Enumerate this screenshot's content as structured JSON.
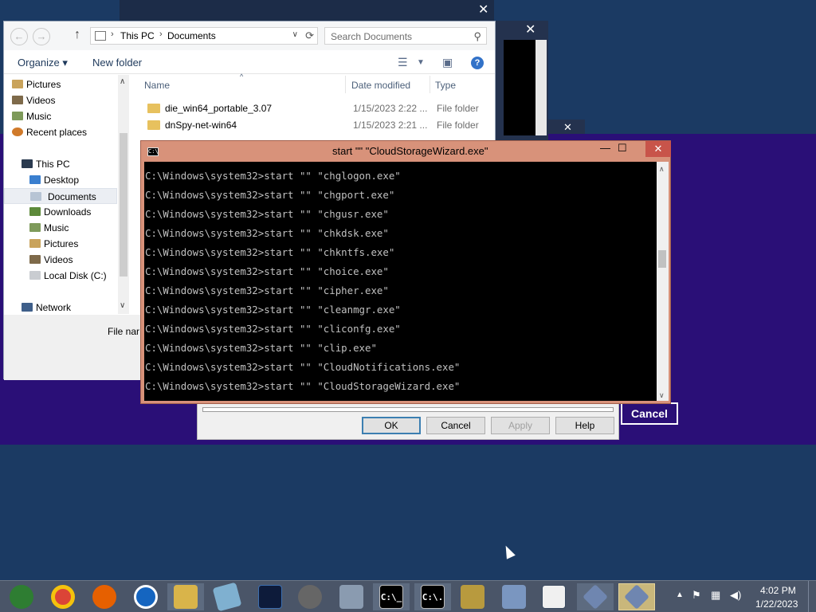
{
  "explorer": {
    "path": [
      "This PC",
      "Documents"
    ],
    "search_placeholder": "Search Documents",
    "organize_label": "Organize",
    "new_folder_label": "New folder",
    "columns": {
      "name": "Name",
      "date_modified": "Date modified",
      "type": "Type"
    },
    "nav_items": [
      {
        "label": "Pictures",
        "icon": "pictures-icon"
      },
      {
        "label": "Videos",
        "icon": "videos-icon"
      },
      {
        "label": "Music",
        "icon": "music-icon"
      },
      {
        "label": "Recent places",
        "icon": "recent-places-icon"
      },
      {
        "label": "This PC",
        "icon": "computer-icon"
      },
      {
        "label": "Desktop",
        "icon": "desktop-icon"
      },
      {
        "label": "Documents",
        "icon": "documents-icon",
        "selected": true
      },
      {
        "label": "Downloads",
        "icon": "downloads-icon"
      },
      {
        "label": "Music",
        "icon": "music-icon"
      },
      {
        "label": "Pictures",
        "icon": "pictures-icon"
      },
      {
        "label": "Videos",
        "icon": "videos-icon"
      },
      {
        "label": "Local Disk (C:)",
        "icon": "drive-icon"
      },
      {
        "label": "Network",
        "icon": "network-icon"
      }
    ],
    "files": [
      {
        "name": "die_win64_portable_3.07",
        "date": "1/15/2023 2:22 ...",
        "type": "File folder"
      },
      {
        "name": "dnSpy-net-win64",
        "date": "1/15/2023 2:21 ...",
        "type": "File folder"
      }
    ],
    "file_name_label": "File nar"
  },
  "properties_dialog": {
    "ok_label": "OK",
    "cancel_label": "Cancel",
    "apply_label": "Apply",
    "help_label": "Help"
  },
  "background_cancel_label": "Cancel",
  "cmd": {
    "title": "start \"\" \"CloudStorageWizard.exe\"",
    "lines": [
      "C:\\Windows\\system32>start \"\" \"chglogon.exe\"",
      "C:\\Windows\\system32>start \"\" \"chgport.exe\"",
      "C:\\Windows\\system32>start \"\" \"chgusr.exe\"",
      "C:\\Windows\\system32>start \"\" \"chkdsk.exe\"",
      "C:\\Windows\\system32>start \"\" \"chkntfs.exe\"",
      "C:\\Windows\\system32>start \"\" \"choice.exe\"",
      "C:\\Windows\\system32>start \"\" \"cipher.exe\"",
      "C:\\Windows\\system32>start \"\" \"cleanmgr.exe\"",
      "C:\\Windows\\system32>start \"\" \"cliconfg.exe\"",
      "C:\\Windows\\system32>start \"\" \"clip.exe\"",
      "C:\\Windows\\system32>start \"\" \"CloudNotifications.exe\"",
      "C:\\Windows\\system32>start \"\" \"CloudStorageWizard.exe\""
    ]
  },
  "taskbar": {
    "apps": [
      {
        "name": "chrome-alt-icon",
        "color": "#2e7d32"
      },
      {
        "name": "chrome-icon",
        "color": "#db4437"
      },
      {
        "name": "firefox-icon",
        "color": "#e66000"
      },
      {
        "name": "obama-logo-icon",
        "color": "#1565c0"
      },
      {
        "name": "file-explorer-icon",
        "color": "#d9b44a"
      },
      {
        "name": "notepad-icon",
        "color": "#7fb0d0"
      },
      {
        "name": "flame-app-icon",
        "color": "#0d1b3a"
      },
      {
        "name": "skull-app-icon",
        "color": "#666666"
      },
      {
        "name": "performance-monitor-icon",
        "color": "#8a9bb0"
      },
      {
        "name": "cmd-icon",
        "color": "#000000",
        "glyph": "C:\\_"
      },
      {
        "name": "cmd-icon-2",
        "color": "#000000",
        "glyph": "C:\\."
      },
      {
        "name": "keys-icon",
        "color": "#b89a3e"
      },
      {
        "name": "calculator-icon",
        "color": "#7a96c0"
      },
      {
        "name": "document-viewer-icon",
        "color": "#f0f0f0"
      },
      {
        "name": "diamond-app-icon",
        "color": "#6f86b0"
      },
      {
        "name": "diamond-app-icon-2",
        "color": "#6f86b0"
      }
    ],
    "time": "4:02 PM",
    "date": "1/22/2023"
  }
}
